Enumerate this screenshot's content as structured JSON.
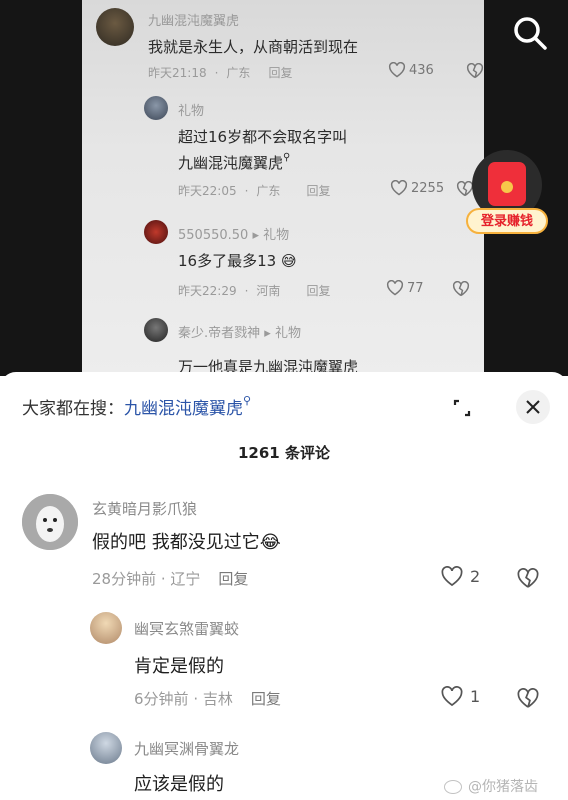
{
  "video": {
    "comments": [
      {
        "name": "九幽混沌魔翼虎",
        "text": "我就是永生人，从商朝活到现在",
        "time": "昨天21:18",
        "region": "广东",
        "reply": "回复",
        "likes": "436"
      },
      {
        "name": "礼物",
        "text1": "超过16岁都不会取名字叫",
        "text2": "九幽混沌魔翼虎",
        "time": "昨天22:05",
        "region": "广东",
        "reply": "回复",
        "likes": "2255"
      },
      {
        "name": "550550.50",
        "gift": "礼物",
        "text": "16多了最多13",
        "time": "昨天22:29",
        "region": "河南",
        "reply": "回复",
        "likes": "77"
      },
      {
        "name": "秦少.帝者戮神",
        "gift": "礼物",
        "text": "万一他真是九幽混沌魔翼虎"
      }
    ],
    "redpack_label": "登录赚钱"
  },
  "sheet": {
    "search_prefix": "大家都在搜：",
    "search_term": "九幽混沌魔翼虎",
    "count": "1261 条评论",
    "comments": [
      {
        "name": "玄黄暗月影爪狼",
        "text": "假的吧 我都没见过它",
        "time": "28分钟前",
        "region": "辽宁",
        "reply": "回复",
        "likes": "2"
      },
      {
        "name": "幽冥玄煞雷翼蛟",
        "text": "肯定是假的",
        "time": "6分钟前",
        "region": "吉林",
        "reply": "回复",
        "likes": "1"
      },
      {
        "name": "九幽冥渊骨翼龙",
        "text": "应该是假的"
      }
    ]
  },
  "watermark": "@你猪落齿",
  "colors": {
    "link": "#2c55a8",
    "redpack": "#ef2f3a",
    "sheet_bg": "#ffffff"
  }
}
